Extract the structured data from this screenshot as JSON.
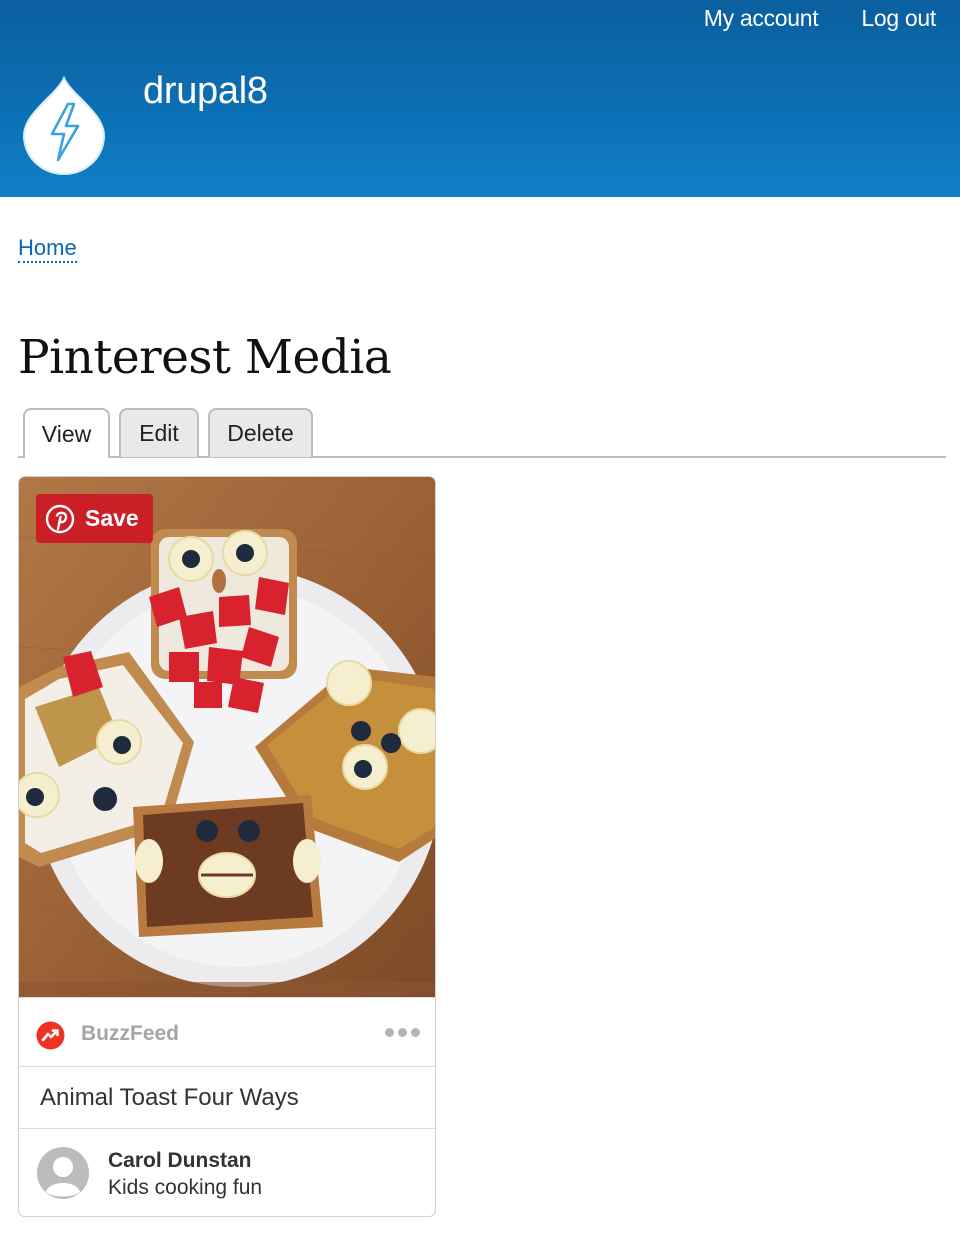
{
  "header": {
    "site_name": "drupal8",
    "user_menu": [
      "My account",
      "Log out"
    ],
    "logo_icon": "drupal-drop-lightning-icon",
    "colors": {
      "gradient_top": "#0a5f9e",
      "gradient_bottom": "#0f80c6"
    }
  },
  "breadcrumb": {
    "home": "Home"
  },
  "page": {
    "title": "Pinterest Media"
  },
  "tabs": [
    {
      "label": "View",
      "active": true
    },
    {
      "label": "Edit",
      "active": false
    },
    {
      "label": "Delete",
      "active": false
    }
  ],
  "pin": {
    "save_label": "Save",
    "save_color": "#cb1f27",
    "image_icon": "animal-toast-photo",
    "source": "BuzzFeed",
    "more_icon": "more-dots-icon",
    "description": "Animal Toast Four Ways",
    "board_owner": "Carol Dunstan",
    "board_name": "Kids cooking fun"
  }
}
